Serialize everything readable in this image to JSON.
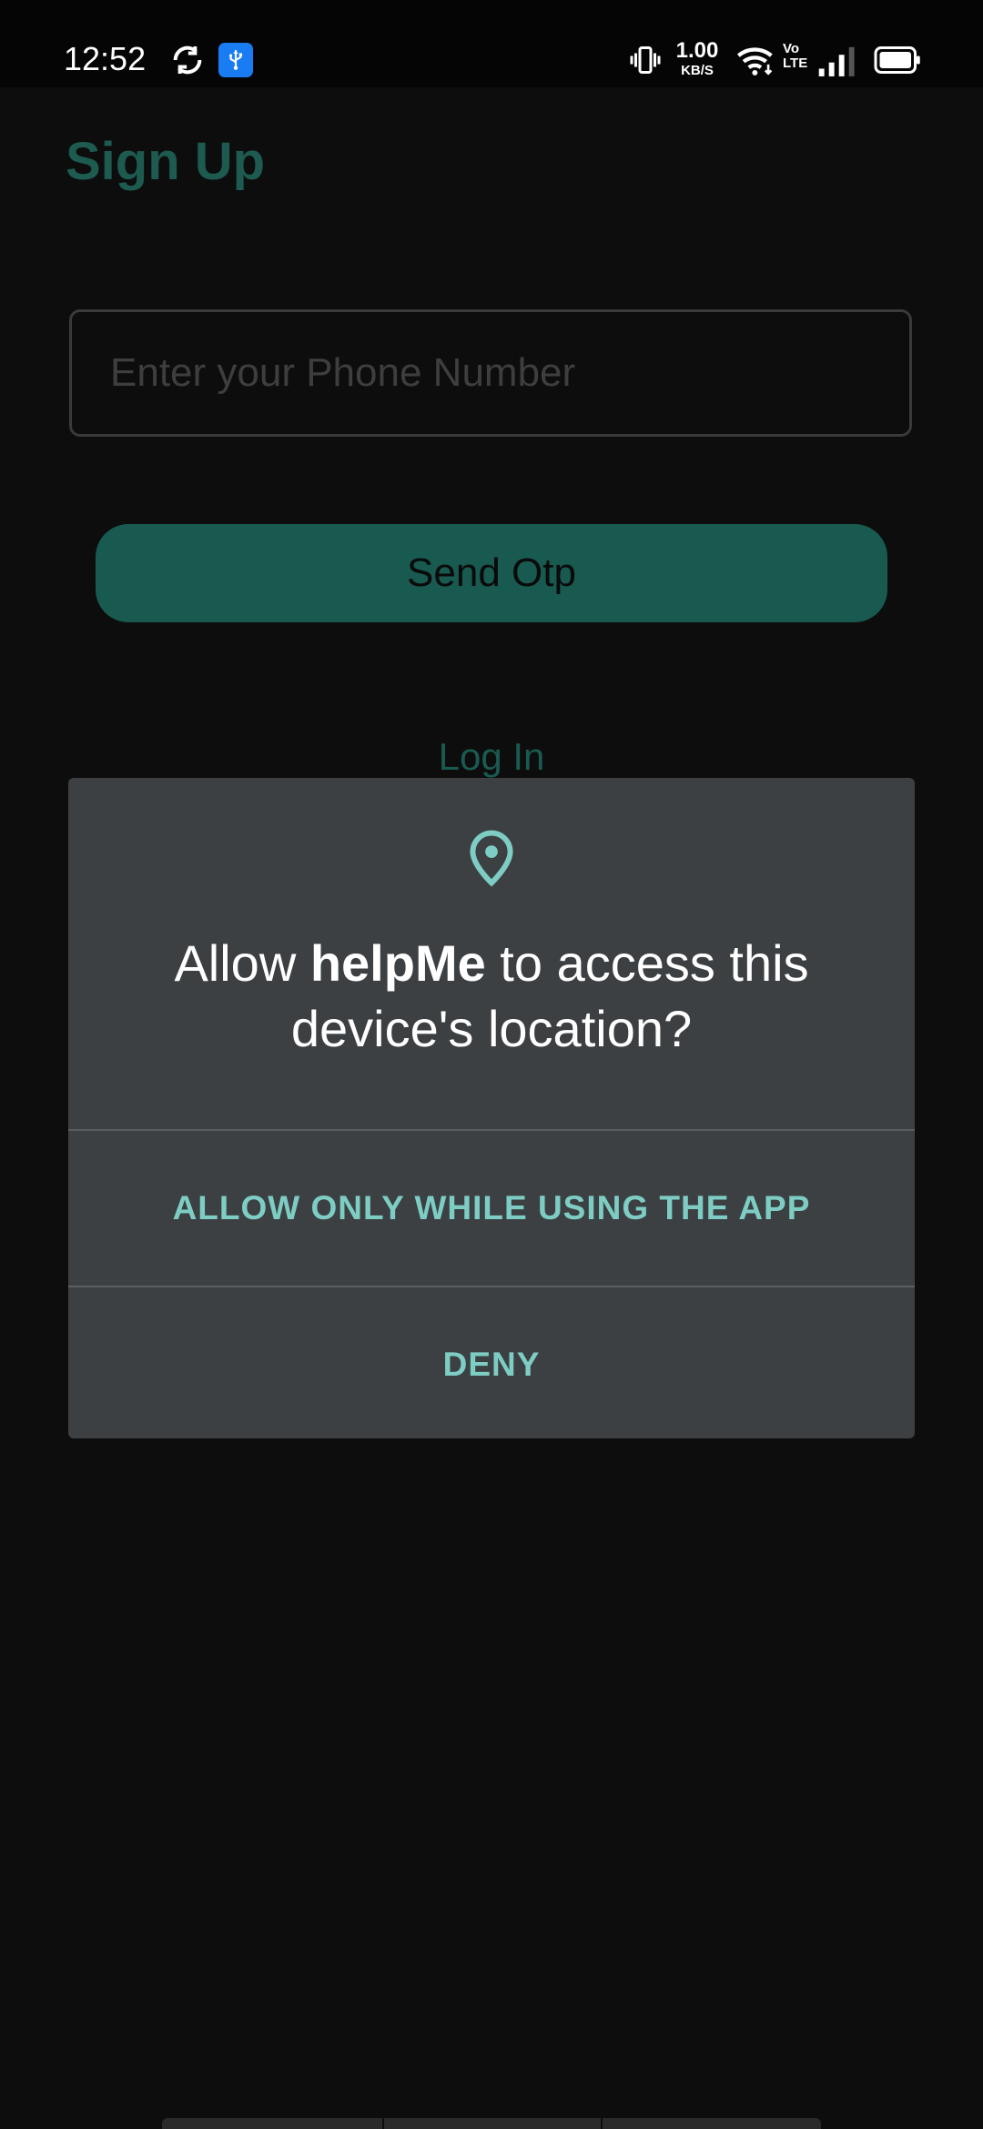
{
  "status_bar": {
    "time": "12:52",
    "network_speed_value": "1.00",
    "network_speed_unit": "KB/S",
    "volte_label_top": "Vo",
    "volte_label_bottom": "LTE",
    "icons": [
      "sync-icon",
      "usb-icon",
      "vibrate-icon",
      "wifi-icon",
      "signal-icon",
      "battery-icon"
    ]
  },
  "page": {
    "title": "Sign Up",
    "phone_placeholder": "Enter your Phone Number",
    "phone_value": "",
    "send_otp_label": "Send Otp",
    "login_link": "Log In"
  },
  "dialog": {
    "icon": "location-pin-icon",
    "message_prefix": "Allow ",
    "app_name": "helpMe",
    "message_suffix": " to access this device's location?",
    "allow_label": "ALLOW ONLY WHILE USING THE APP",
    "deny_label": "DENY"
  },
  "colors": {
    "background": "#0d0d0d",
    "accent": "#185a50",
    "dialog_bg": "#3c4043",
    "dialog_accent_text": "#7ecdc4",
    "usb_badge": "#1a7cf2"
  }
}
